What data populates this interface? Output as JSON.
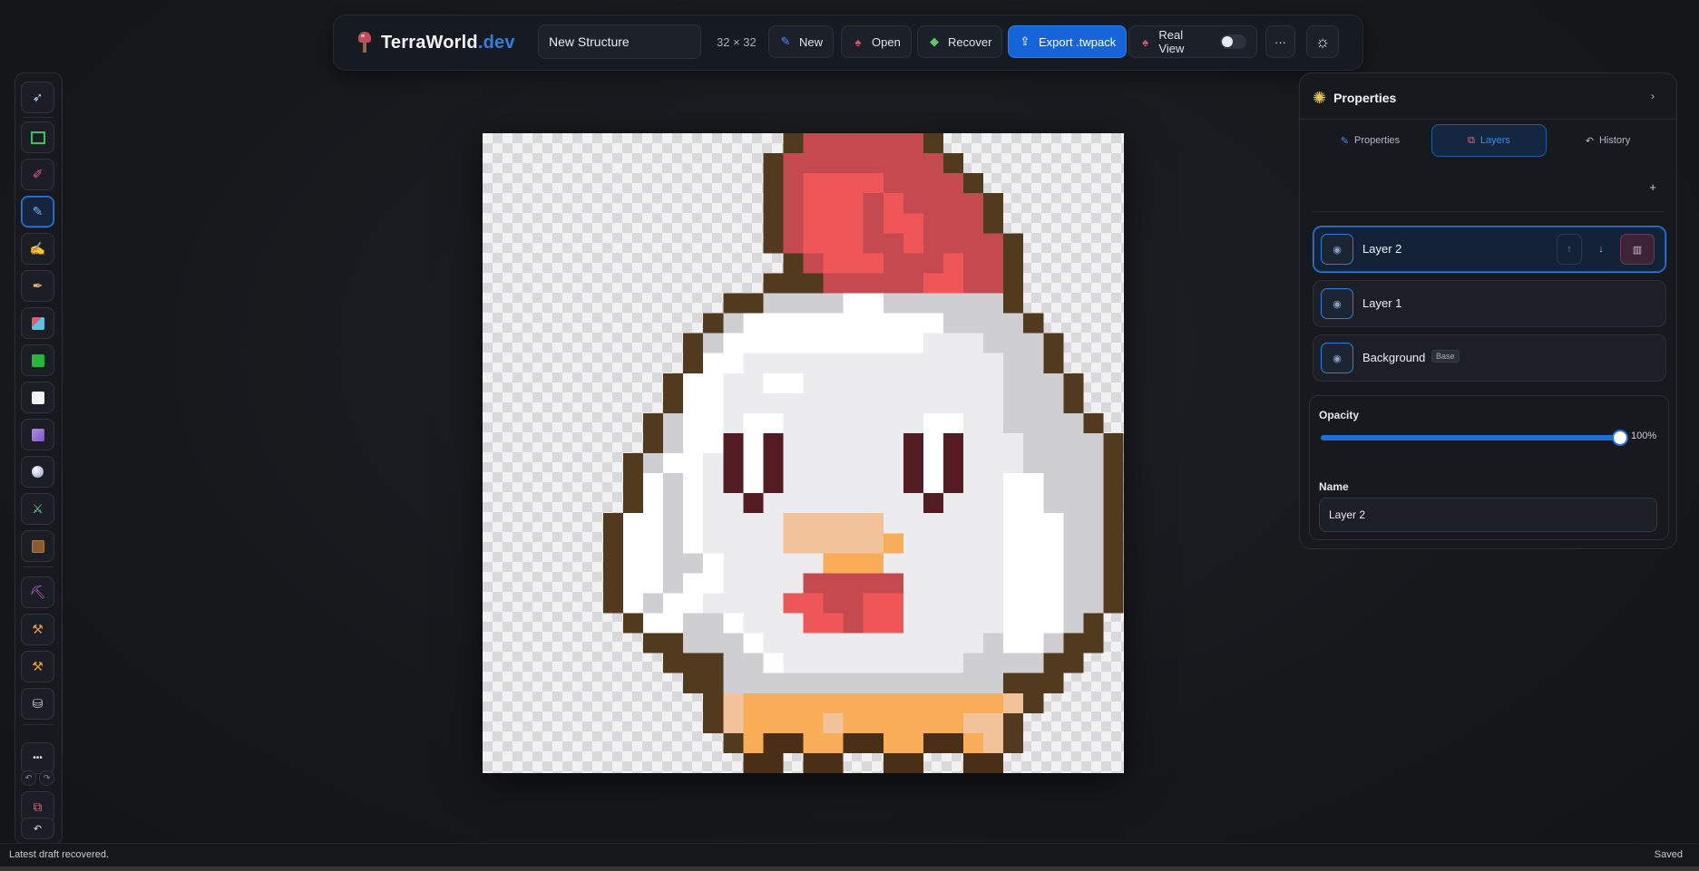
{
  "app": {
    "brand_main": "TerraWorld",
    "brand_suffix": ".dev",
    "structure_name": "New Structure",
    "dimensions": "32 × 32",
    "buttons": {
      "new": "New",
      "open": "Open",
      "recover": "Recover",
      "export": "Export .twpack",
      "real_view": "Real View",
      "more": "···"
    },
    "real_view_enabled": false,
    "accent": "#1664d9"
  },
  "toolbar": {
    "tools": [
      "cursor-tool",
      "select-tool",
      "picker-tool",
      "pencil-tool",
      "brush-tool",
      "paint-brush-tool",
      "wall-tool",
      "grass-block",
      "white-block",
      "purple-block",
      "orb-tool",
      "sword-tool",
      "crate-tool",
      "pickaxe-tool",
      "hammer-tool",
      "axe-tool",
      "bucket-tool"
    ],
    "active_tool": "pencil-tool",
    "more": "•••",
    "undo": "↶",
    "redo": "↷"
  },
  "canvas": {
    "grid_size": 32
  },
  "panel": {
    "title": "Properties",
    "collapse": "›",
    "tabs": [
      {
        "label": "Properties",
        "icon": "brush"
      },
      {
        "label": "Layers",
        "icon": "layers"
      },
      {
        "label": "History",
        "icon": "undo"
      }
    ],
    "active_tab": "Layers",
    "add_layer": "+",
    "layers": [
      {
        "name": "Layer 2",
        "active": true
      },
      {
        "name": "Layer 1",
        "active": false
      },
      {
        "name": "Background",
        "active": false,
        "badge": "Base"
      }
    ],
    "layer_buttons": {
      "up": "↑",
      "down": "↓",
      "delete": "🗑"
    },
    "opacity_label": "Opacity",
    "opacity_value": 1.0,
    "opacity_text": "100%",
    "name_label": "Name",
    "name_value": "Layer 2"
  },
  "status": {
    "left": "Latest draft recovered.",
    "right": "Saved"
  }
}
